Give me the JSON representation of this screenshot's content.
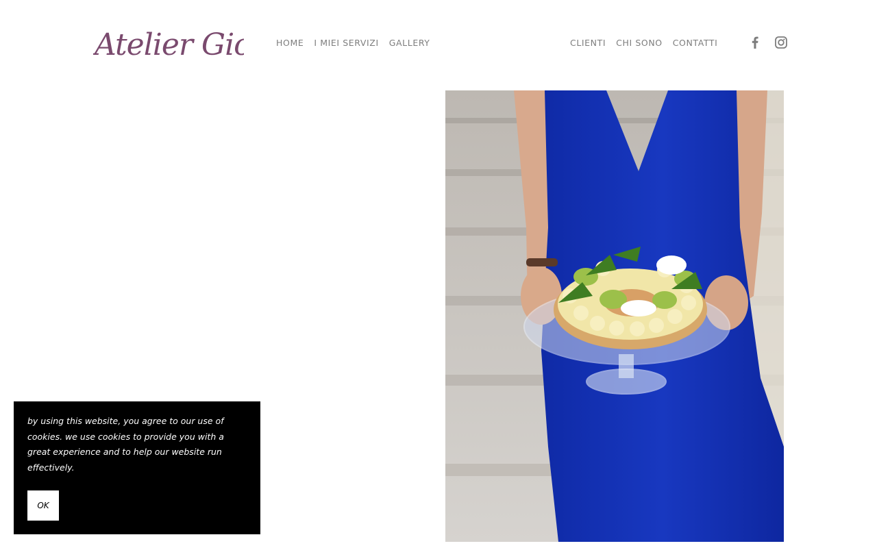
{
  "brand": {
    "logo_text": "Atelier Giovi",
    "color": "#7a4a6e"
  },
  "nav": {
    "left_items": [
      "HOME",
      "I MIEI SERVIZI",
      "GALLERY"
    ],
    "right_items": [
      "CLIENTI",
      "CHI SONO",
      "CONTATTI"
    ],
    "color": "#7d7d7d"
  },
  "social": [
    {
      "icon": "facebook-icon"
    },
    {
      "icon": "instagram-icon"
    }
  ],
  "hero": {
    "subject": "woman-in-blue-dress-holding-cake-photo",
    "dress_color": "#1637b8"
  },
  "cookie_banner": {
    "text": "by using this website, you agree to our use of cookies. we use cookies to provide you with a great experience and to help our website run effectively.",
    "ok_label": "OK",
    "background": "#000000"
  }
}
